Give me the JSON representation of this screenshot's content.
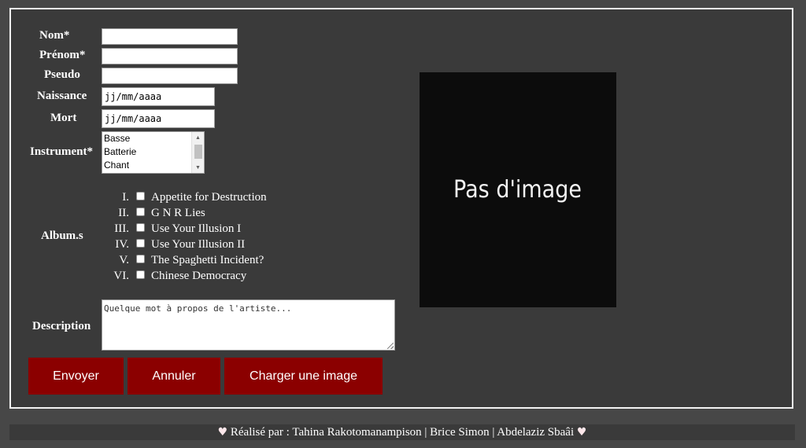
{
  "form": {
    "labels": {
      "nom": "Nom*",
      "prenom": "Prénom*",
      "pseudo": "Pseudo",
      "naissance": "Naissance",
      "mort": "Mort",
      "instrument": "Instrument*",
      "albums": "Album.s",
      "description": "Description"
    },
    "values": {
      "nom": "",
      "prenom": "",
      "pseudo": ""
    },
    "date_placeholder": "jj/mm/aaaa",
    "instruments": [
      "Basse",
      "Batterie",
      "Chant"
    ],
    "albums": [
      {
        "num": "I.",
        "name": "Appetite for Destruction",
        "checked": false
      },
      {
        "num": "II.",
        "name": "G N R Lies",
        "checked": false
      },
      {
        "num": "III.",
        "name": "Use Your Illusion I",
        "checked": false
      },
      {
        "num": "IV.",
        "name": "Use Your Illusion II",
        "checked": false
      },
      {
        "num": "V.",
        "name": "The Spaghetti Incident?",
        "checked": false
      },
      {
        "num": "VI.",
        "name": "Chinese Democracy",
        "checked": false
      }
    ],
    "description_placeholder": "Quelque mot à propos de l'artiste..."
  },
  "buttons": {
    "submit": "Envoyer",
    "cancel": "Annuler",
    "upload": "Charger une image"
  },
  "preview": {
    "text": "Pas d'image"
  },
  "footer": {
    "heart_icon": "heart-icon",
    "text": "Réalisé par : Tahina Rakotomanampison | Brice Simon | Abdelaziz Sbaâi"
  },
  "colors": {
    "button": "#8b0000",
    "panel": "#3a3a3a",
    "border": "#f2f2f2"
  }
}
